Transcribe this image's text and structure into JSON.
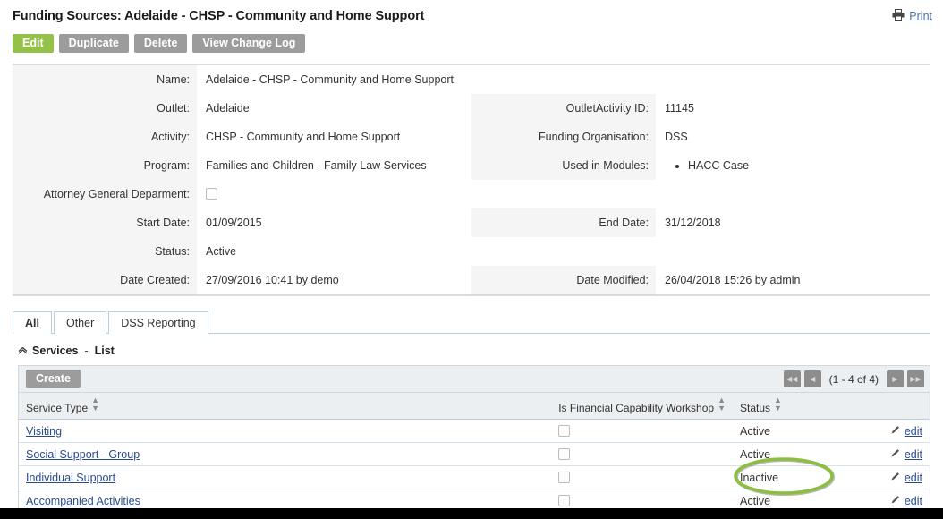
{
  "header": {
    "title": "Funding Sources: Adelaide - CHSP - Community and Home Support",
    "print_label": "Print",
    "print_icon": "printer-icon"
  },
  "actions": [
    {
      "label": "Edit",
      "style": "primary"
    },
    {
      "label": "Duplicate",
      "style": "default"
    },
    {
      "label": "Delete",
      "style": "default"
    },
    {
      "label": "View Change Log",
      "style": "default"
    }
  ],
  "detail": {
    "rows": [
      {
        "left": {
          "label": "Name:",
          "value": "Adelaide - CHSP - Community and Home Support"
        },
        "right": {
          "label": "",
          "value": ""
        }
      },
      {
        "left": {
          "label": "Outlet:",
          "value": "Adelaide"
        },
        "right": {
          "label": "OutletActivity ID:",
          "value": "11145"
        }
      },
      {
        "left": {
          "label": "Activity:",
          "value": "CHSP - Community and Home Support"
        },
        "right": {
          "label": "Funding Organisation:",
          "value": "DSS"
        }
      },
      {
        "left": {
          "label": "Program:",
          "value": "Families and Children - Family Law Services"
        },
        "right": {
          "label": "Used in Modules:",
          "value": "HACC Case",
          "type": "bullet-list"
        }
      },
      {
        "left": {
          "label": "Attorney General Deparment:",
          "value": "",
          "type": "checkbox",
          "checked": false
        },
        "right": {
          "label": "",
          "value": ""
        }
      },
      {
        "left": {
          "label": "Start Date:",
          "value": "01/09/2015"
        },
        "right": {
          "label": "End Date:",
          "value": "31/12/2018"
        }
      },
      {
        "left": {
          "label": "Status:",
          "value": "Active"
        },
        "right": {
          "label": "",
          "value": ""
        }
      },
      {
        "left": {
          "label": "Date Created:",
          "value": "27/09/2016 10:41 by demo"
        },
        "right": {
          "label": "Date Modified:",
          "value": "26/04/2018 15:26 by admin"
        }
      }
    ]
  },
  "tabs": [
    {
      "label": "All",
      "active": true
    },
    {
      "label": "Other",
      "active": false
    },
    {
      "label": "DSS Reporting",
      "active": false
    }
  ],
  "panel": {
    "collapse_icon": "chevron-up-icon",
    "title": "Services",
    "separator": "-",
    "subtitle": "List"
  },
  "grid": {
    "create_label": "Create",
    "pager": {
      "first_label": "◀◀",
      "prev_label": "◀",
      "count_label": "(1 - 4 of 4)",
      "next_label": "▶",
      "last_label": "▶▶"
    },
    "columns": [
      {
        "label": "Service Type",
        "sortable": true
      },
      {
        "label": "Is Financial Capability Workshop",
        "sortable": true
      },
      {
        "label": "Status",
        "sortable": true
      },
      {
        "label": "",
        "sortable": false
      }
    ],
    "rows": [
      {
        "service_type": "Visiting",
        "is_fcw": false,
        "status": "Active",
        "edit_label": "edit"
      },
      {
        "service_type": "Social Support - Group",
        "is_fcw": false,
        "status": "Active",
        "edit_label": "edit"
      },
      {
        "service_type": "Individual Support",
        "is_fcw": false,
        "status": "Inactive",
        "edit_label": "edit"
      },
      {
        "service_type": "Accompanied Activities",
        "is_fcw": false,
        "status": "Active",
        "edit_label": "edit"
      }
    ]
  },
  "annotation": {
    "shape": "ellipse-highlight",
    "target_text": "Inactive",
    "color": "#8cbf3f"
  },
  "colors": {
    "primary_button": "#94c149",
    "default_button": "#9c9c9c",
    "link": "#2a4b8d",
    "annotation": "#8cbf3f"
  }
}
